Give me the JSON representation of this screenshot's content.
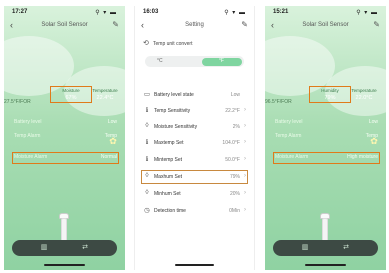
{
  "phone1": {
    "time": "17:27",
    "status_icons": "⚲ ▾ ▬",
    "title": "Solar Soil Sensor",
    "temp_side": "27.5°F/FOR",
    "readings": [
      {
        "label": "Moisture",
        "value": "67%"
      },
      {
        "label": "Temperature",
        "value": "22.4°C"
      }
    ],
    "rows": [
      {
        "key": "Battery level",
        "value": "Low"
      },
      {
        "key": "Temp Alarm",
        "value": "Temp"
      },
      {
        "key": "Moisture Alarm",
        "value": "Normal"
      }
    ]
  },
  "phone2": {
    "time": "16:03",
    "status_icons": "⚲ ▾ ▬",
    "title": "Setting",
    "temp_convert_label": "Temp unit convert",
    "segment": {
      "left": "°C",
      "right": "°F"
    },
    "rows": [
      {
        "icon": "battery-icon",
        "glyph": "▭",
        "key": "Battery level state",
        "value": "Low",
        "chevron": ""
      },
      {
        "icon": "thermometer-icon",
        "glyph": "ℹ",
        "key": "Temp Sensitivity",
        "value": "22.2°F",
        "chevron": "›"
      },
      {
        "icon": "drop-icon",
        "glyph": "◊",
        "key": "Moisture Sensitivity",
        "value": "2%",
        "chevron": "›"
      },
      {
        "icon": "thermometer-icon",
        "glyph": "ℹ",
        "key": "Maxtemp Set",
        "value": "104.0°F",
        "chevron": "›"
      },
      {
        "icon": "thermometer-icon",
        "glyph": "ℹ",
        "key": "Mintemp Set",
        "value": "50.0°F",
        "chevron": "›"
      },
      {
        "icon": "drop-icon",
        "glyph": "◊",
        "key": "Maxhum Set",
        "value": "79%",
        "chevron": "›"
      },
      {
        "icon": "drop-icon",
        "glyph": "◊",
        "key": "Minhum Set",
        "value": "20%",
        "chevron": "›"
      },
      {
        "icon": "clock-icon",
        "glyph": "◷",
        "key": "Detection time",
        "value": "0Min",
        "chevron": "›"
      }
    ]
  },
  "phone3": {
    "time": "15:21",
    "status_icons": "⚲ ▾ ▬",
    "title": "Solar Soil Sensor",
    "temp_side": "96.5°F/FOR",
    "readings": [
      {
        "label": "Humidity",
        "value": "79%"
      },
      {
        "label": "Temperature",
        "value": "22.0°C"
      }
    ],
    "rows": [
      {
        "key": "Battery level",
        "value": "Low"
      },
      {
        "key": "Temp Alarm",
        "value": "Temp"
      },
      {
        "key": "Moisture Alarm",
        "value": "High moisture"
      }
    ]
  },
  "icons": {
    "back": "‹",
    "edit": "✎",
    "chart": "▥",
    "swap": "⇄",
    "flower": "✿",
    "sync": "⟲"
  },
  "colors": {
    "highlight": "#e07a1a",
    "toggle_on": "#7fd5a0",
    "bottom_bar": "#3d4a44"
  }
}
